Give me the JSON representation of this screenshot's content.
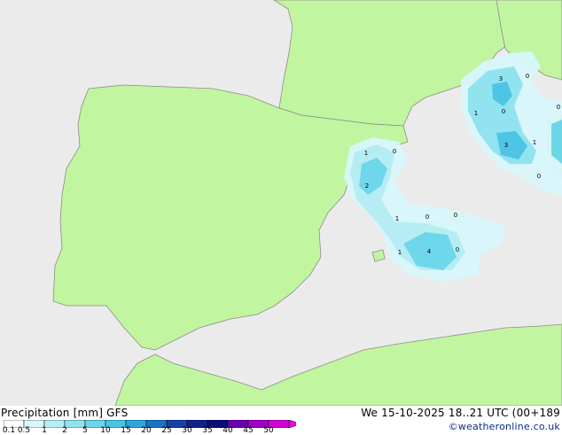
{
  "title_left": "Precipitation [mm]  GFS",
  "title_right": "We 15-10-2025 18..21 UTC (00+189",
  "credit": "©weatheronline.co.uk",
  "legend": {
    "ticks": [
      "0.1",
      "0.5",
      "1",
      "2",
      "5",
      "10",
      "15",
      "20",
      "25",
      "30",
      "35",
      "40",
      "45",
      "50"
    ],
    "colors": [
      "#ffffff",
      "#d9f7fb",
      "#b4eef6",
      "#8ee3f1",
      "#68d6ec",
      "#47c4e6",
      "#2aa6dc",
      "#1a74c4",
      "#1542a9",
      "#13208c",
      "#0c0d78",
      "#6b00b0",
      "#a300c8",
      "#d400d4",
      "#ee00ee"
    ]
  },
  "map_colors": {
    "sea": "#ebebeb",
    "land": "#c2f5a0",
    "coast": "#8c8c8c"
  },
  "contour_values": [
    "1",
    "0",
    "2",
    "1",
    "0",
    "0",
    "1",
    "4",
    "0",
    "3",
    "0",
    "1",
    "0",
    "3",
    "1",
    "0",
    "0"
  ]
}
